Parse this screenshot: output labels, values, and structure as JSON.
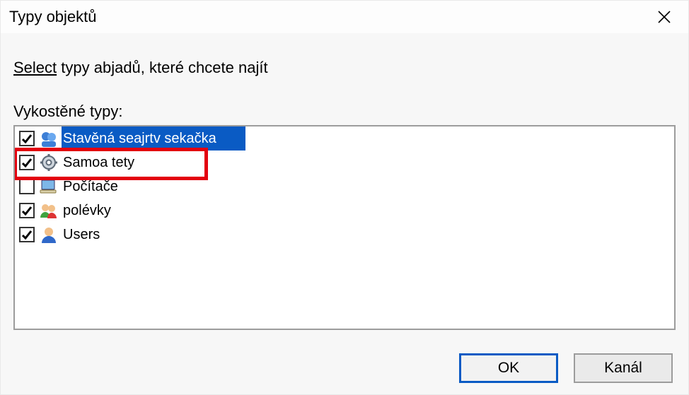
{
  "window": {
    "title": "Typy objektů"
  },
  "prompt": {
    "emph": "Select",
    "rest": " typy abjadů, které chcete najít"
  },
  "list_label": "Vykostěné typy:",
  "object_types": [
    {
      "label": "Stavěná seajrtv sekačka",
      "checked": true,
      "selected": true,
      "icon": "group-head-icon",
      "highlight": false
    },
    {
      "label": "Samoa tety",
      "checked": true,
      "selected": false,
      "icon": "gear-icon",
      "highlight": true
    },
    {
      "label": "Počítače",
      "checked": false,
      "selected": false,
      "icon": "computer-icon",
      "highlight": false
    },
    {
      "label": "polévky",
      "checked": true,
      "selected": false,
      "icon": "users-icon",
      "highlight": false
    },
    {
      "label": "Users",
      "checked": true,
      "selected": false,
      "icon": "single-user-icon",
      "highlight": false
    }
  ],
  "buttons": {
    "ok": "OK",
    "cancel": "Kanál"
  }
}
